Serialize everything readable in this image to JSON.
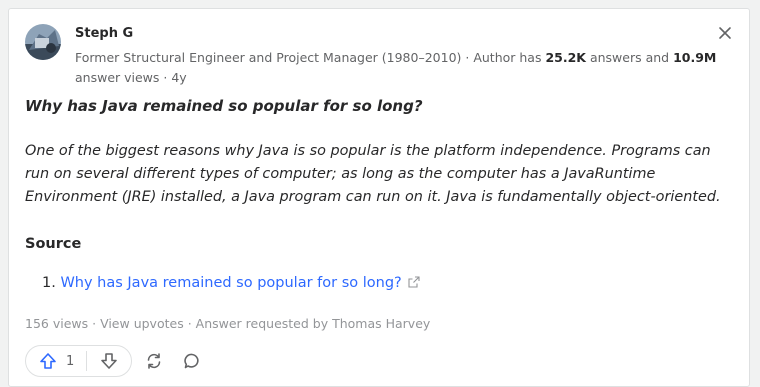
{
  "author": {
    "name": "Steph G",
    "credential_prefix": "Former Structural Engineer and Project Manager (1980–2010) · Author has ",
    "answers_count": "25.2K",
    "answers_mid": " answers and ",
    "views_count": "10.9M",
    "views_suffix": " answer views · 4y"
  },
  "question": "Why has Java remained so popular for so long?",
  "answer": "One of the biggest reasons why Java is so popular is the platform independence. Programs can run on several different types of computer; as long as the computer has a JavaRuntime Environment (JRE) installed, a Java program can run on it. Java is fundamentally object-oriented.",
  "source": {
    "heading": "Source",
    "item_number": "1.",
    "link_text": "Why has Java remained so popular for so long?"
  },
  "meta": {
    "views": "156 views",
    "sep": " · ",
    "view_upvotes": "View upvotes",
    "requested": "Answer requested by Thomas Harvey"
  },
  "actions": {
    "upvote_count": "1"
  },
  "icons": {
    "close": "close-icon",
    "upvote": "upvote-arrow-icon",
    "downvote": "downvote-arrow-icon",
    "share": "reshare-icon",
    "comment": "comment-icon",
    "external": "external-link-icon"
  },
  "colors": {
    "accent": "#2e69ff",
    "muted": "#939598",
    "text": "#282829"
  }
}
